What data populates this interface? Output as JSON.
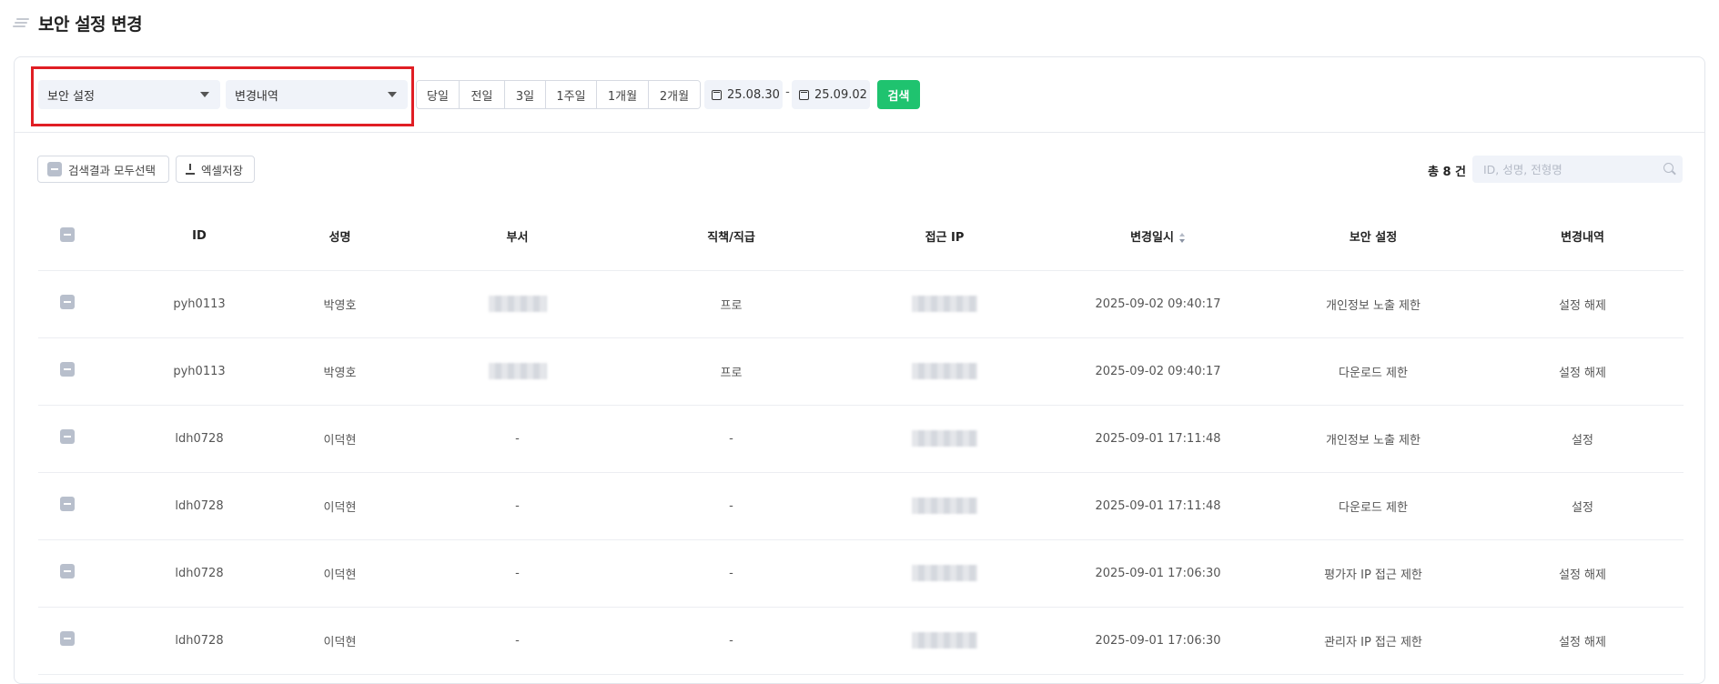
{
  "page": {
    "title": "보안 설정 변경"
  },
  "filters": {
    "select1": "보안 설정",
    "select2": "변경내역",
    "periods": [
      "당일",
      "전일",
      "3일",
      "1주일",
      "1개월",
      "2개월"
    ],
    "date_from": "25.08.30",
    "date_separator": "-",
    "date_to": "25.09.02",
    "search_label": "검색"
  },
  "toolbar": {
    "select_all_label": "검색결과 모두선택",
    "excel_label": "엑셀저장",
    "total_label": "총 8 건",
    "search_placeholder": "ID, 성명, 전형명"
  },
  "table": {
    "columns": [
      "ID",
      "성명",
      "부서",
      "직책/직급",
      "접근 IP",
      "변경일시",
      "보안 설정",
      "변경내역"
    ],
    "rows": [
      {
        "id": "pyh0113",
        "name": "박영호",
        "dept": "",
        "position": "프로",
        "ip": "",
        "datetime": "2025-09-02 09:40:17",
        "setting": "개인정보 노출 제한",
        "change": "설정 해제"
      },
      {
        "id": "pyh0113",
        "name": "박영호",
        "dept": "",
        "position": "프로",
        "ip": "",
        "datetime": "2025-09-02 09:40:17",
        "setting": "다운로드 제한",
        "change": "설정 해제"
      },
      {
        "id": "ldh0728",
        "name": "이덕현",
        "dept": "-",
        "position": "-",
        "ip": "",
        "datetime": "2025-09-01 17:11:48",
        "setting": "개인정보 노출 제한",
        "change": "설정"
      },
      {
        "id": "ldh0728",
        "name": "이덕현",
        "dept": "-",
        "position": "-",
        "ip": "",
        "datetime": "2025-09-01 17:11:48",
        "setting": "다운로드 제한",
        "change": "설정"
      },
      {
        "id": "ldh0728",
        "name": "이덕현",
        "dept": "-",
        "position": "-",
        "ip": "",
        "datetime": "2025-09-01 17:06:30",
        "setting": "평가자 IP 접근 제한",
        "change": "설정 해제"
      },
      {
        "id": "ldh0728",
        "name": "이덕현",
        "dept": "-",
        "position": "-",
        "ip": "",
        "datetime": "2025-09-01 17:06:30",
        "setting": "관리자 IP 접근 제한",
        "change": "설정 해제"
      }
    ]
  }
}
